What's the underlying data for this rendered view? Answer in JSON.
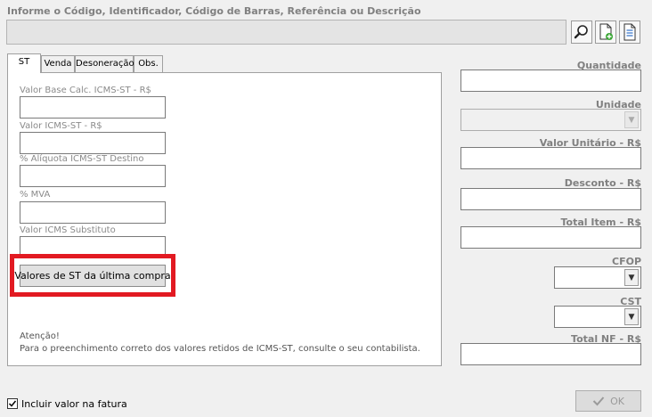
{
  "header": {
    "search_label": "Informe o Código, Identificador, Código de Barras, Referência ou Descrição",
    "search_value": "",
    "tools": [
      {
        "icon": "magnifier-icon"
      },
      {
        "icon": "add-document-icon"
      },
      {
        "icon": "document-icon"
      }
    ]
  },
  "tabs": [
    {
      "label": "ST",
      "active": true
    },
    {
      "label": "Venda",
      "active": false
    },
    {
      "label": "Desoneração",
      "active": false
    },
    {
      "label": "Obs.",
      "active": false
    }
  ],
  "st_panel": {
    "fields": [
      {
        "label": "Valor Base Calc. ICMS-ST - R$",
        "value": ""
      },
      {
        "label": "Valor ICMS-ST - R$",
        "value": ""
      },
      {
        "label": "% Alíquota ICMS-ST Destino",
        "value": ""
      },
      {
        "label": "% MVA",
        "value": ""
      },
      {
        "label": "Valor ICMS Substituto",
        "value": ""
      }
    ],
    "last_purchase_button": "Valores de ST da última compra",
    "attention_title": "Atenção!",
    "attention_text": "Para o preenchimento correto dos valores retidos de ICMS-ST, consulte o seu contabilista."
  },
  "right_panel": {
    "quantidade": {
      "label": "Quantidade",
      "value": ""
    },
    "unidade": {
      "label": "Unidade",
      "value": ""
    },
    "valor_unitario": {
      "label": "Valor Unitário - R$",
      "value": ""
    },
    "desconto": {
      "label": "Desconto - R$",
      "value": ""
    },
    "total_item": {
      "label": "Total Item - R$",
      "value": ""
    },
    "cfop": {
      "label": "CFOP",
      "value": ""
    },
    "cst": {
      "label": "CST",
      "value": ""
    },
    "total_nf": {
      "label": "Total NF - R$",
      "value": ""
    }
  },
  "footer": {
    "include_invoice_label": "Incluir valor na fatura",
    "include_invoice_checked": true,
    "ok_label": "OK"
  },
  "colors": {
    "highlight": "#e21a22",
    "label_grey": "#808080"
  }
}
